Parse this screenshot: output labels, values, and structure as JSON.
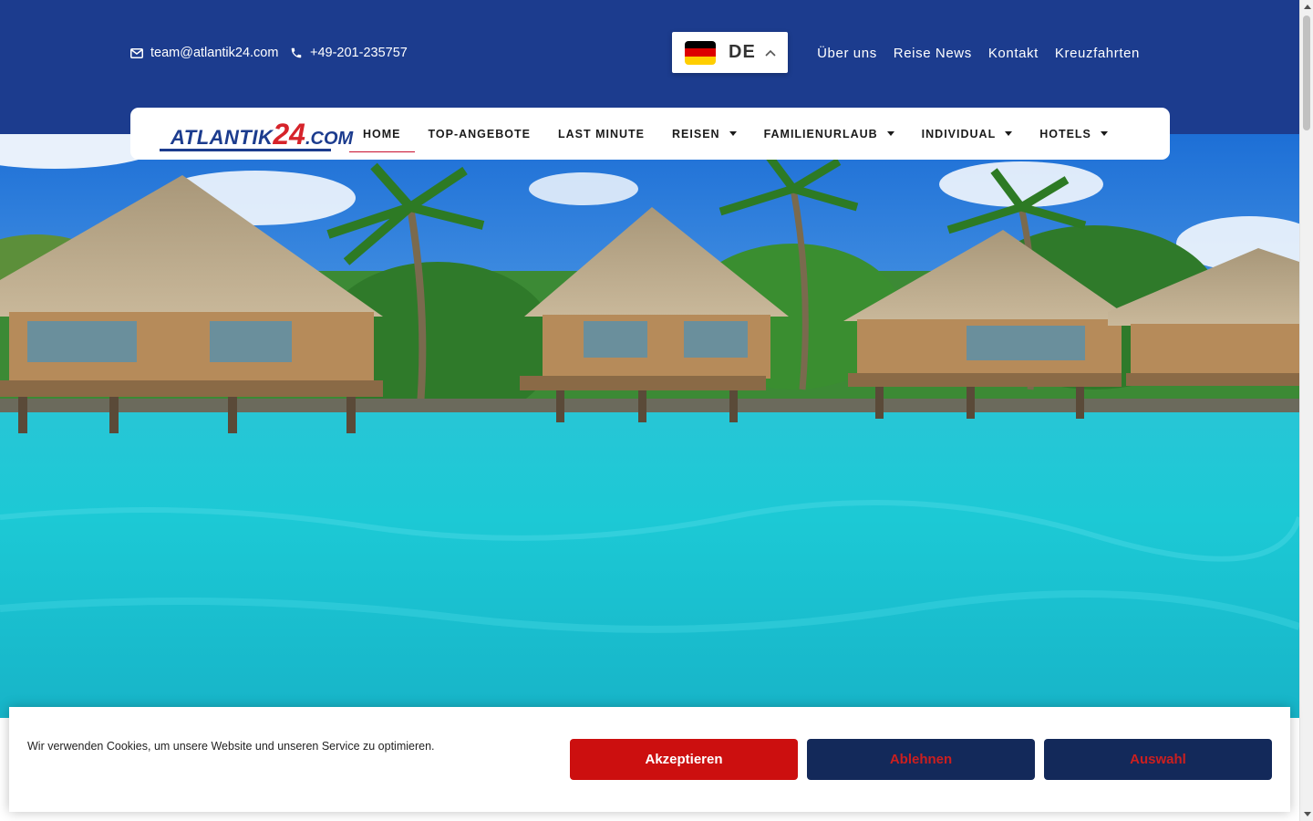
{
  "header": {
    "email": "team@atlantik24.com",
    "phone": "+49-201-235757",
    "language": {
      "code": "DE",
      "flag": [
        "#000000",
        "#dd0000",
        "#ffce00"
      ]
    },
    "links": [
      "Über uns",
      "Reise News",
      "Kontakt",
      "Kreuzfahrten"
    ]
  },
  "logo": {
    "part1": "ATLANTIK",
    "part2": "24",
    "part3": ".COM"
  },
  "nav": {
    "items": [
      {
        "label": "HOME",
        "active": true,
        "dropdown": false
      },
      {
        "label": "TOP-ANGEBOTE",
        "active": false,
        "dropdown": false
      },
      {
        "label": "LAST MINUTE",
        "active": false,
        "dropdown": false
      },
      {
        "label": "REISEN",
        "active": false,
        "dropdown": true
      },
      {
        "label": "FAMILIENURLAUB",
        "active": false,
        "dropdown": true
      },
      {
        "label": "INDIVIDUAL",
        "active": false,
        "dropdown": true
      },
      {
        "label": "HOTELS",
        "active": false,
        "dropdown": true
      }
    ]
  },
  "cookie": {
    "text": "Wir verwenden Cookies, um unsere Website und unseren Service zu optimieren.",
    "accept": "Akzeptieren",
    "deny": "Ablehnen",
    "choice": "Auswahl"
  },
  "colors": {
    "brand_blue": "#1c3c8e",
    "accent_red": "#cc0f0f",
    "dark_navy": "#13295a"
  },
  "icons": [
    "envelope-icon",
    "phone-icon",
    "chevron-up-icon",
    "caret-down-icon"
  ]
}
